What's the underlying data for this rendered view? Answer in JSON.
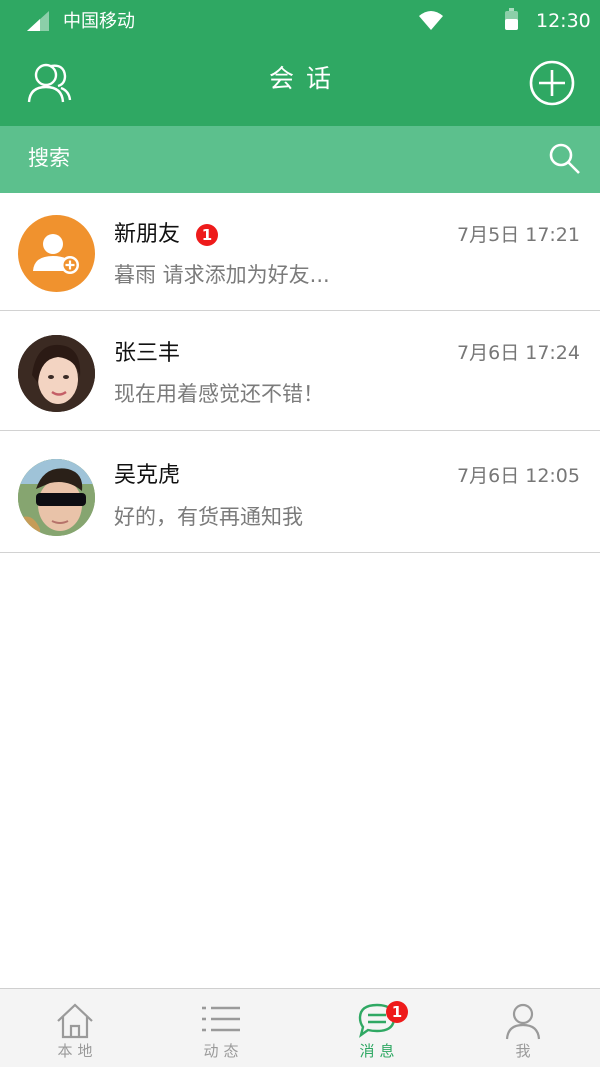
{
  "status_bar": {
    "carrier": "中国移动",
    "time": "12:30"
  },
  "header": {
    "title": "会话"
  },
  "search": {
    "label": "搜索"
  },
  "conversations": [
    {
      "name": "新朋友",
      "badge": "1",
      "time": "7月5日 17:21",
      "message": "暮雨 请求添加为好友..."
    },
    {
      "name": "张三丰",
      "time": "7月6日 17:24",
      "message": "现在用着感觉还不错！"
    },
    {
      "name": "吴克虎",
      "time": "7月6日 12:05",
      "message": "好的，有货再通知我"
    }
  ],
  "tabs": [
    {
      "label": "本地",
      "icon": "home-icon"
    },
    {
      "label": "动态",
      "icon": "list-icon"
    },
    {
      "label": "消息",
      "icon": "chat-icon",
      "badge": "1",
      "active": true
    },
    {
      "label": "我",
      "icon": "person-icon"
    }
  ],
  "colors": {
    "primary": "#2fa863",
    "search_bg": "#5cc08d",
    "badge": "#ee1b1b",
    "new_friend_avatar": "#f0922e"
  }
}
